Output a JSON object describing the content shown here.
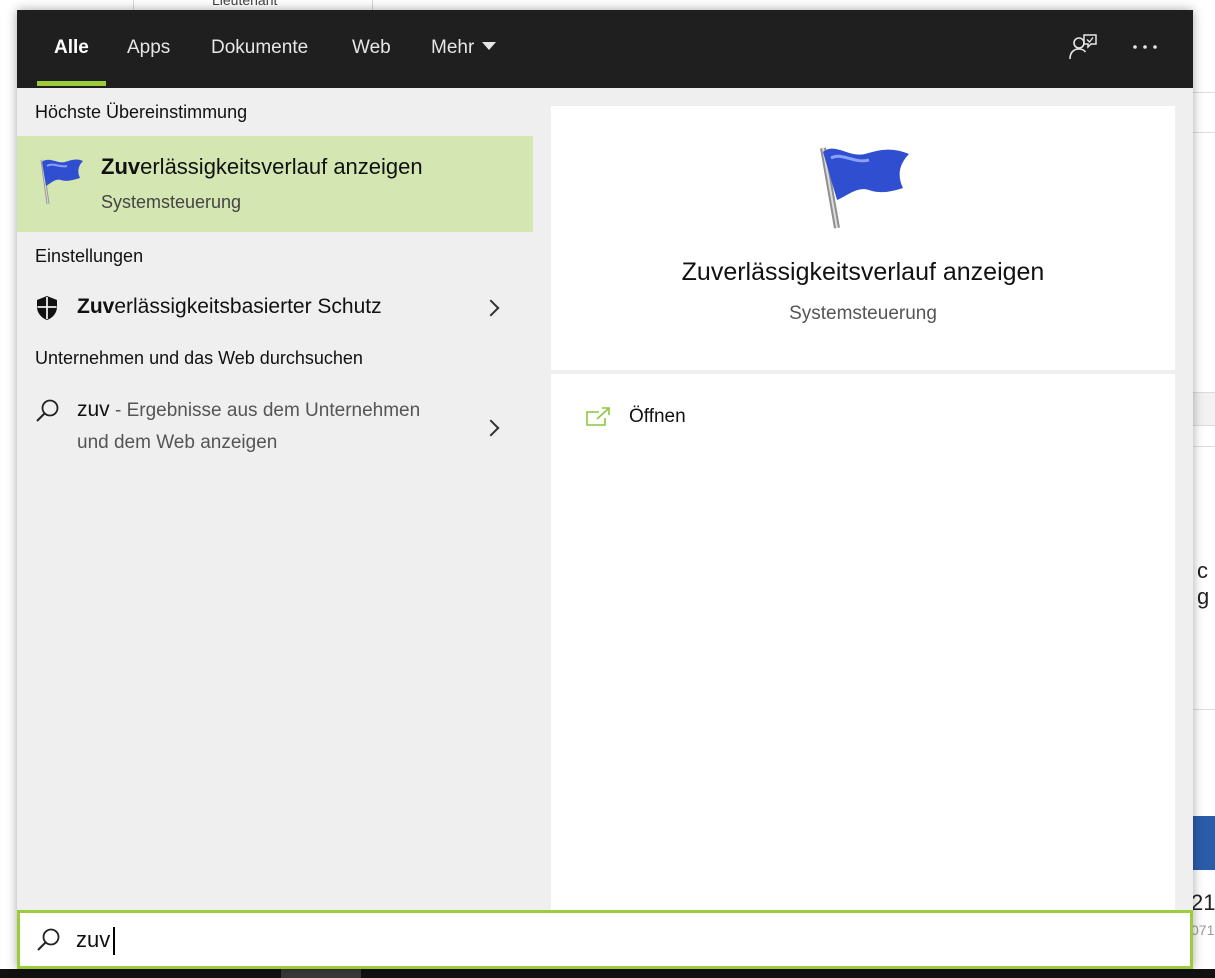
{
  "background": {
    "tab_label": "Lieutenant",
    "peek_text": "c g",
    "peek_number": "21",
    "peek_subtext": "071"
  },
  "tabs": {
    "all": "Alle",
    "apps": "Apps",
    "documents": "Dokumente",
    "web": "Web",
    "more": "Mehr"
  },
  "sections": {
    "best_match": "Höchste Übereinstimmung",
    "settings": "Einstellungen",
    "web_search": "Unternehmen und das Web durchsuchen"
  },
  "best_match": {
    "title_bold": "Zuv",
    "title_rest": "erlässigkeitsverlauf anzeigen",
    "subtitle": "Systemsteuerung"
  },
  "settings_item": {
    "title_bold": "Zuv",
    "title_rest": "erlässigkeitsbasierter Schutz"
  },
  "web_item": {
    "query": "zuv",
    "text": " - Ergebnisse aus dem Unternehmen und dem Web anzeigen"
  },
  "preview": {
    "title": "Zuverlässigkeitsverlauf anzeigen",
    "subtitle": "Systemsteuerung",
    "open_label": "Öffnen"
  },
  "search": {
    "value": "zuv"
  },
  "colors": {
    "accent": "#9ccc3c",
    "selection": "#d4e6b1",
    "topbar": "#1f1f1f",
    "flag_blue": "#2f4fd0"
  }
}
